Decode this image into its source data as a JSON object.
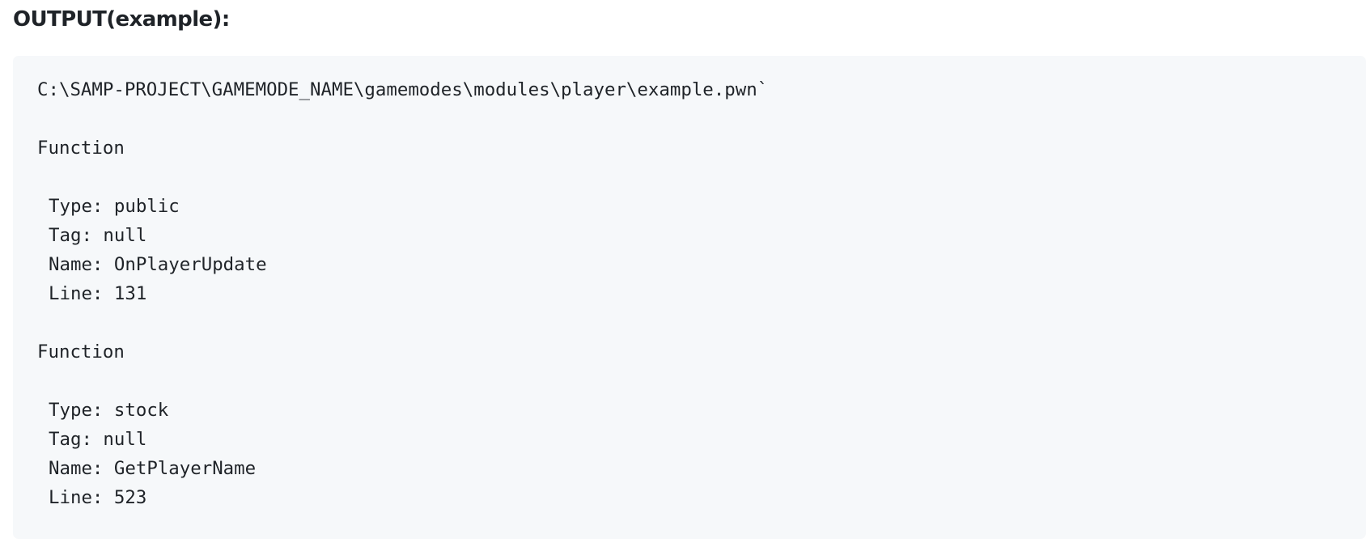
{
  "heading": "OUTPUT(example):",
  "code": {
    "path": "C:\\SAMP-PROJECT\\GAMEMODE_NAME\\gamemodes\\modules\\player\\example.pwn`",
    "functions": [
      {
        "label": "Function",
        "type": "Type: public",
        "tag": "Tag: null",
        "name": "Name: OnPlayerUpdate",
        "line": "Line: 131"
      },
      {
        "label": "Function",
        "type": "Type: stock",
        "tag": "Tag: null",
        "name": "Name: GetPlayerName",
        "line": "Line: 523"
      }
    ]
  }
}
